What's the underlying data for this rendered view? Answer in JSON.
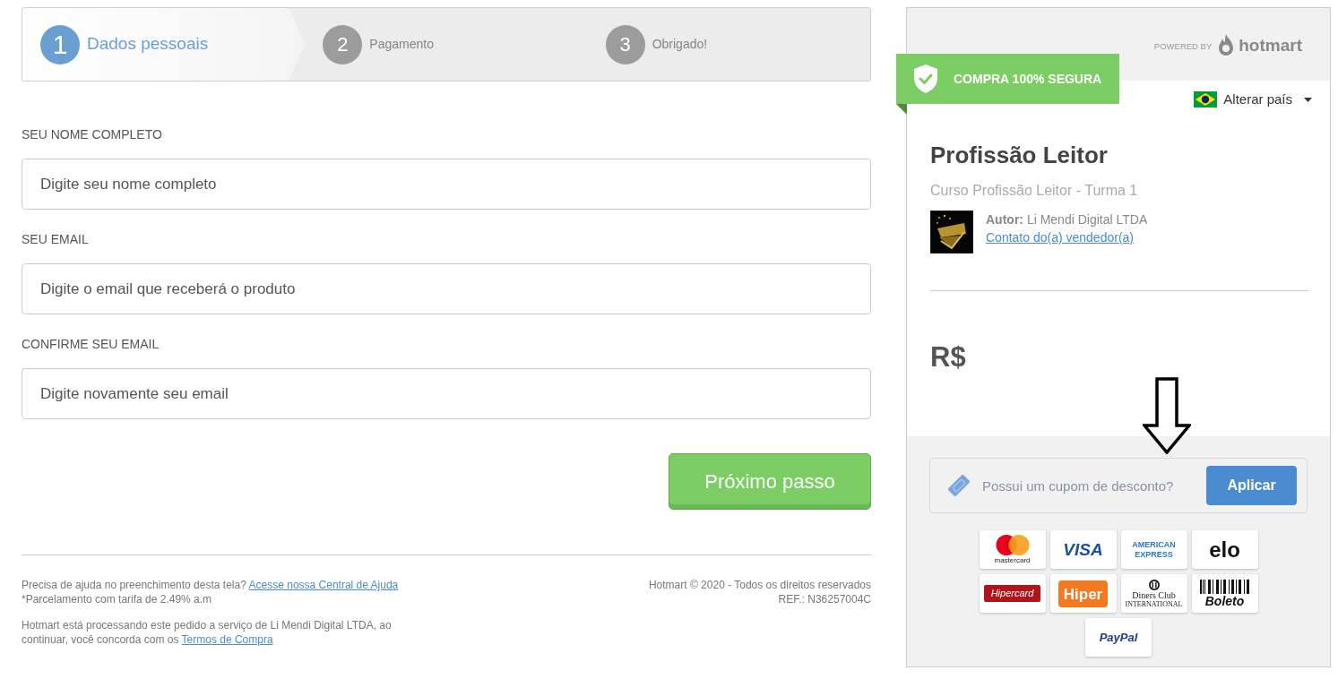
{
  "steps": [
    {
      "number": "1",
      "label": "Dados pessoais",
      "selected": true
    },
    {
      "number": "2",
      "label": "Pagamento",
      "selected": false
    },
    {
      "number": "3",
      "label": "Obrigado!",
      "selected": false
    }
  ],
  "form": {
    "fields": [
      {
        "label": "SEU NOME COMPLETO",
        "placeholder": "Digite seu nome completo"
      },
      {
        "label": "SEU EMAIL",
        "placeholder": "Digite o email que receberá o produto"
      },
      {
        "label": "CONFIRME SEU EMAIL",
        "placeholder": "Digite novamente seu email"
      }
    ],
    "submit": "Próximo passo"
  },
  "footer": {
    "help": {
      "text": "Precisa de ajuda no preenchimento desta tela?",
      "link": "Acesse nossa Central de Ajuda"
    },
    "installment_note": "*Parcelamento com tarifa de 2.49% a.m",
    "processing": {
      "text": "Hotmart está processando este pedido a serviço de Li Mendi Digital LTDA, ao continuar, você concorda com os",
      "link": "Termos de Compra"
    },
    "copyright": "Hotmart © 2020 - Todos os direitos reservados",
    "reference": "REF.: N36257004C"
  },
  "summary": {
    "powered_by": "POWERED BY",
    "brand": "hotmart",
    "secure_badge": "COMPRA 100% SEGURA",
    "country_selector": "Alterar país",
    "product_title": "Profissão Leitor",
    "product_subtitle": "Curso Profissão Leitor - Turma 1",
    "author": "**Autor:** Li Mendi Digital LTDA",
    "seller_contact": "Contato do(a) vendedor(a)",
    "price": "R$",
    "coupon": {
      "placeholder": "Possui um cupom de desconto?",
      "button": "Aplicar"
    },
    "payment_methods": [
      {
        "kind": "mastercard",
        "label": "mastercard"
      },
      {
        "kind": "visa",
        "label": "VISA"
      },
      {
        "kind": "amex",
        "label": "AMERICAN EXPRESS"
      },
      {
        "kind": "elo",
        "label": "elo"
      },
      {
        "kind": "hipercard",
        "label": "Hipercard"
      },
      {
        "kind": "hiper",
        "label": "Hiper"
      },
      {
        "kind": "diners",
        "label": "Diners Club",
        "sublabel": "INTERNATIONAL"
      },
      {
        "kind": "boleto",
        "label": "Boleto"
      },
      {
        "kind": "paypal",
        "label": "PayPal"
      }
    ]
  }
}
